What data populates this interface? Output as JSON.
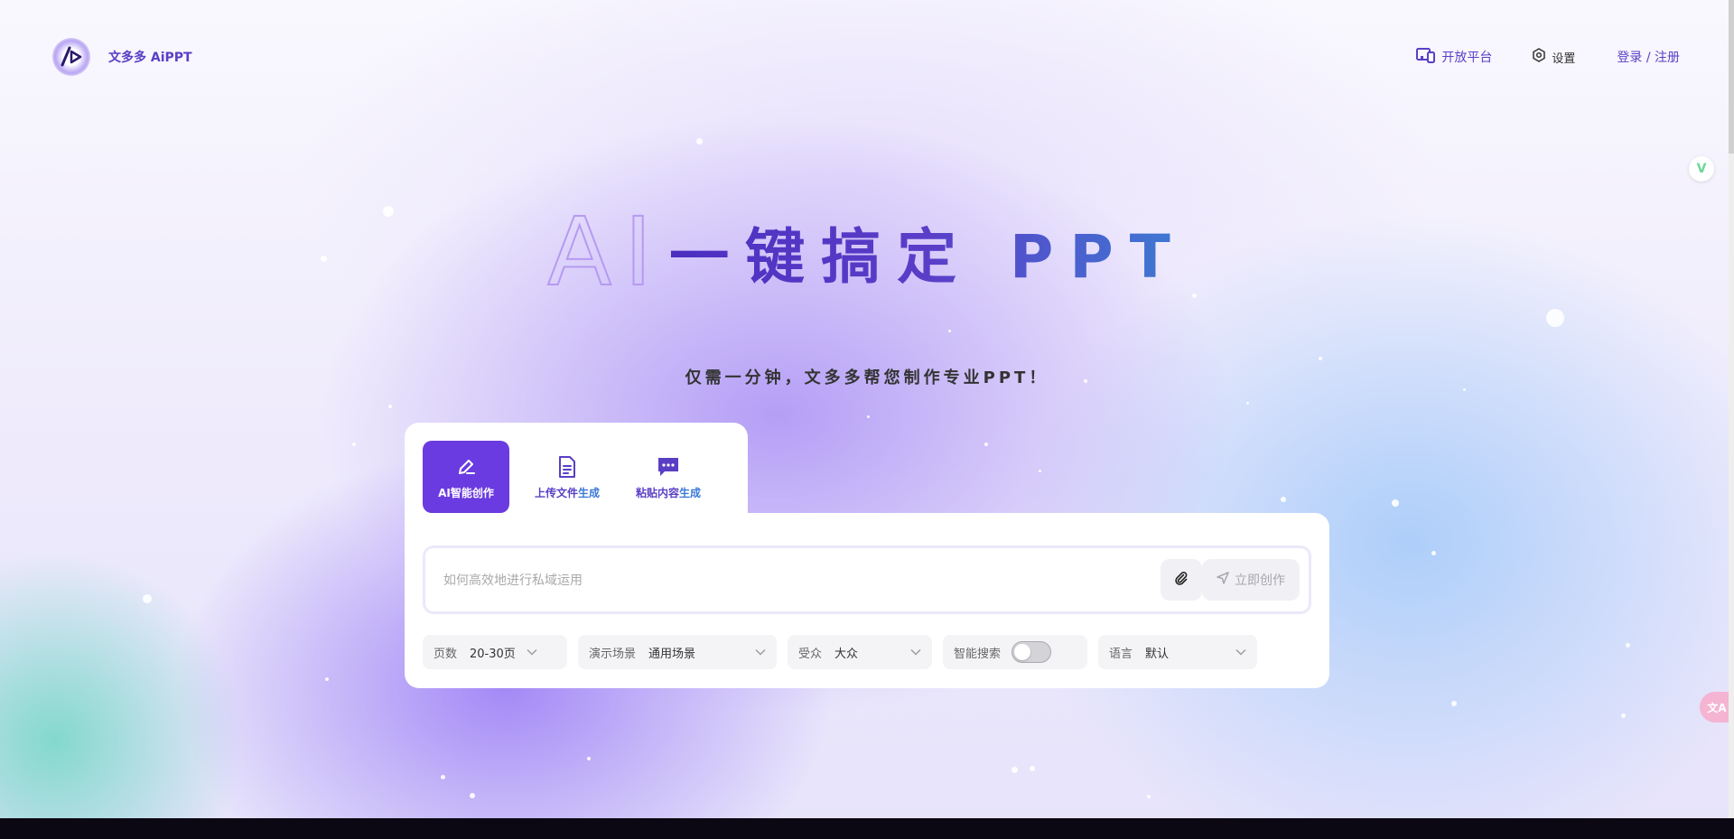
{
  "header": {
    "logo_text": "文多多 AiPPT",
    "nav": {
      "open_platform": "开放平台",
      "settings": "设置",
      "login": "登录 / 注册"
    }
  },
  "hero": {
    "title_ai": "AI",
    "title_rest": "一键搞定 PPT",
    "subtitle": "仅需一分钟，文多多帮您制作专业PPT！"
  },
  "tabs": [
    {
      "label": "AI智能创作",
      "active": true
    },
    {
      "label_a": "上传文件",
      "label_b": "生成"
    },
    {
      "label_a": "粘贴内容",
      "label_b": "生成"
    }
  ],
  "input": {
    "placeholder": "如何高效地进行私域运用",
    "value": "",
    "create_label": "立即创作"
  },
  "options": {
    "pages": {
      "label": "页数",
      "value": "20-30页"
    },
    "scene": {
      "label": "演示场景",
      "value": "通用场景"
    },
    "audience": {
      "label": "受众",
      "value": "大众"
    },
    "smart_search": {
      "label": "智能搜索",
      "enabled": false
    },
    "language": {
      "label": "语言",
      "value": "默认"
    }
  },
  "floating": {
    "translate_label": "文A",
    "badge_label": "V"
  },
  "colors": {
    "accent": "#6a3be0",
    "brand_text": "#5a3fc5",
    "blue_accent": "#3b7ad6"
  }
}
